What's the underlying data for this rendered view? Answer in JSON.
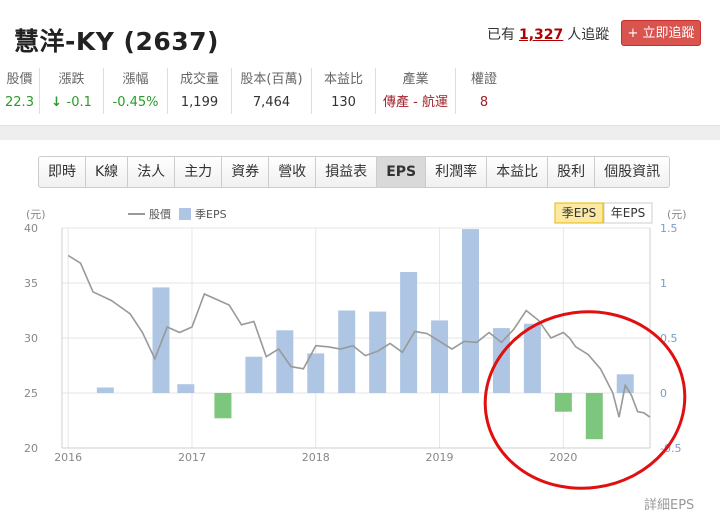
{
  "header": {
    "title": "慧洋-KY (2637)",
    "followers_prefix": "已有",
    "followers_count": "1,327",
    "followers_suffix": "人追蹤",
    "follow_button": "+ 立即追蹤"
  },
  "stats": [
    {
      "label": "股價",
      "value": "22.3",
      "tone": "green",
      "arrow": false
    },
    {
      "label": "漲跌",
      "value": "-0.1",
      "tone": "green",
      "arrow": true
    },
    {
      "label": "漲幅",
      "value": "-0.45%",
      "tone": "green",
      "arrow": false
    },
    {
      "label": "成交量",
      "value": "1,199",
      "tone": "",
      "arrow": false
    },
    {
      "label": "股本(百萬)",
      "value": "7,464",
      "tone": "",
      "arrow": false
    },
    {
      "label": "本益比",
      "value": "130",
      "tone": "",
      "arrow": false
    },
    {
      "label": "產業",
      "value": "傳產 - 航運",
      "tone": "maroon",
      "arrow": false
    },
    {
      "label": "權證",
      "value": "8",
      "tone": "maroon",
      "arrow": false
    }
  ],
  "tabs": [
    "即時",
    "K線",
    "法人",
    "主力",
    "資券",
    "營收",
    "損益表",
    "EPS",
    "利潤率",
    "本益比",
    "股利",
    "個股資訊"
  ],
  "active_tab": "EPS",
  "toggle": {
    "quarterly": "季EPS",
    "annual": "年EPS"
  },
  "detail_link": "詳細EPS",
  "colors": {
    "bar_positive": "#aec6e4",
    "bar_negative": "#7dc67d",
    "price_line": "#999999",
    "annotation_circle": "#e01010",
    "accent_red": "#d9534f"
  },
  "chart_data": {
    "type": "bar+line",
    "legend": [
      {
        "name": "股價",
        "kind": "line"
      },
      {
        "name": "季EPS",
        "kind": "bar"
      }
    ],
    "left_axis": {
      "unit": "(元)",
      "range": [
        20,
        40
      ],
      "ticks": [
        20,
        25,
        30,
        35,
        40
      ]
    },
    "right_axis": {
      "unit": "(元)",
      "range": [
        -0.5,
        1.5
      ],
      "ticks": [
        -0.5,
        0,
        0.5,
        1,
        1.5
      ],
      "tick_labels": [
        "-0.5",
        "0",
        "0.5",
        "1",
        "1.5"
      ]
    },
    "x_axis": {
      "range": [
        2015.95,
        2020.7
      ],
      "ticks": [
        2016,
        2017,
        2018,
        2019,
        2020
      ]
    },
    "grid": true,
    "eps_series": {
      "name": "季EPS",
      "points": [
        {
          "x": 2016.3,
          "value": 0.05
        },
        {
          "x": 2016.75,
          "value": 0.96
        },
        {
          "x": 2016.95,
          "value": 0.08
        },
        {
          "x": 2017.25,
          "value": -0.23
        },
        {
          "x": 2017.5,
          "value": 0.33
        },
        {
          "x": 2017.75,
          "value": 0.57
        },
        {
          "x": 2018.0,
          "value": 0.36
        },
        {
          "x": 2018.25,
          "value": 0.75
        },
        {
          "x": 2018.5,
          "value": 0.74
        },
        {
          "x": 2018.75,
          "value": 1.1
        },
        {
          "x": 2019.0,
          "value": 0.66
        },
        {
          "x": 2019.25,
          "value": 1.49
        },
        {
          "x": 2019.5,
          "value": 0.59
        },
        {
          "x": 2019.75,
          "value": 0.63
        },
        {
          "x": 2020.0,
          "value": -0.17
        },
        {
          "x": 2020.25,
          "value": -0.42
        },
        {
          "x": 2020.5,
          "value": 0.17
        }
      ]
    },
    "price_series": {
      "name": "股價",
      "points": [
        [
          2016.0,
          37.5
        ],
        [
          2016.1,
          36.8
        ],
        [
          2016.2,
          34.2
        ],
        [
          2016.35,
          33.4
        ],
        [
          2016.5,
          32.2
        ],
        [
          2016.6,
          30.5
        ],
        [
          2016.7,
          28.1
        ],
        [
          2016.8,
          31.0
        ],
        [
          2016.9,
          30.5
        ],
        [
          2017.0,
          31.0
        ],
        [
          2017.1,
          34.0
        ],
        [
          2017.2,
          33.5
        ],
        [
          2017.3,
          33.0
        ],
        [
          2017.4,
          31.2
        ],
        [
          2017.5,
          31.5
        ],
        [
          2017.6,
          28.3
        ],
        [
          2017.7,
          29.0
        ],
        [
          2017.8,
          27.4
        ],
        [
          2017.9,
          27.2
        ],
        [
          2018.0,
          29.3
        ],
        [
          2018.1,
          29.2
        ],
        [
          2018.2,
          29.0
        ],
        [
          2018.3,
          29.3
        ],
        [
          2018.4,
          28.4
        ],
        [
          2018.5,
          28.8
        ],
        [
          2018.6,
          29.5
        ],
        [
          2018.7,
          28.7
        ],
        [
          2018.8,
          30.6
        ],
        [
          2018.9,
          30.4
        ],
        [
          2019.0,
          29.7
        ],
        [
          2019.1,
          29.0
        ],
        [
          2019.2,
          29.7
        ],
        [
          2019.3,
          29.6
        ],
        [
          2019.4,
          30.5
        ],
        [
          2019.5,
          29.6
        ],
        [
          2019.6,
          30.8
        ],
        [
          2019.7,
          32.5
        ],
        [
          2019.8,
          31.6
        ],
        [
          2019.9,
          30.0
        ],
        [
          2020.0,
          30.5
        ],
        [
          2020.05,
          30.0
        ],
        [
          2020.1,
          29.2
        ],
        [
          2020.2,
          28.5
        ],
        [
          2020.3,
          27.2
        ],
        [
          2020.4,
          25.0
        ],
        [
          2020.45,
          22.8
        ],
        [
          2020.5,
          25.7
        ],
        [
          2020.55,
          24.8
        ],
        [
          2020.6,
          23.3
        ],
        [
          2020.65,
          23.2
        ],
        [
          2020.7,
          22.8
        ]
      ]
    }
  }
}
